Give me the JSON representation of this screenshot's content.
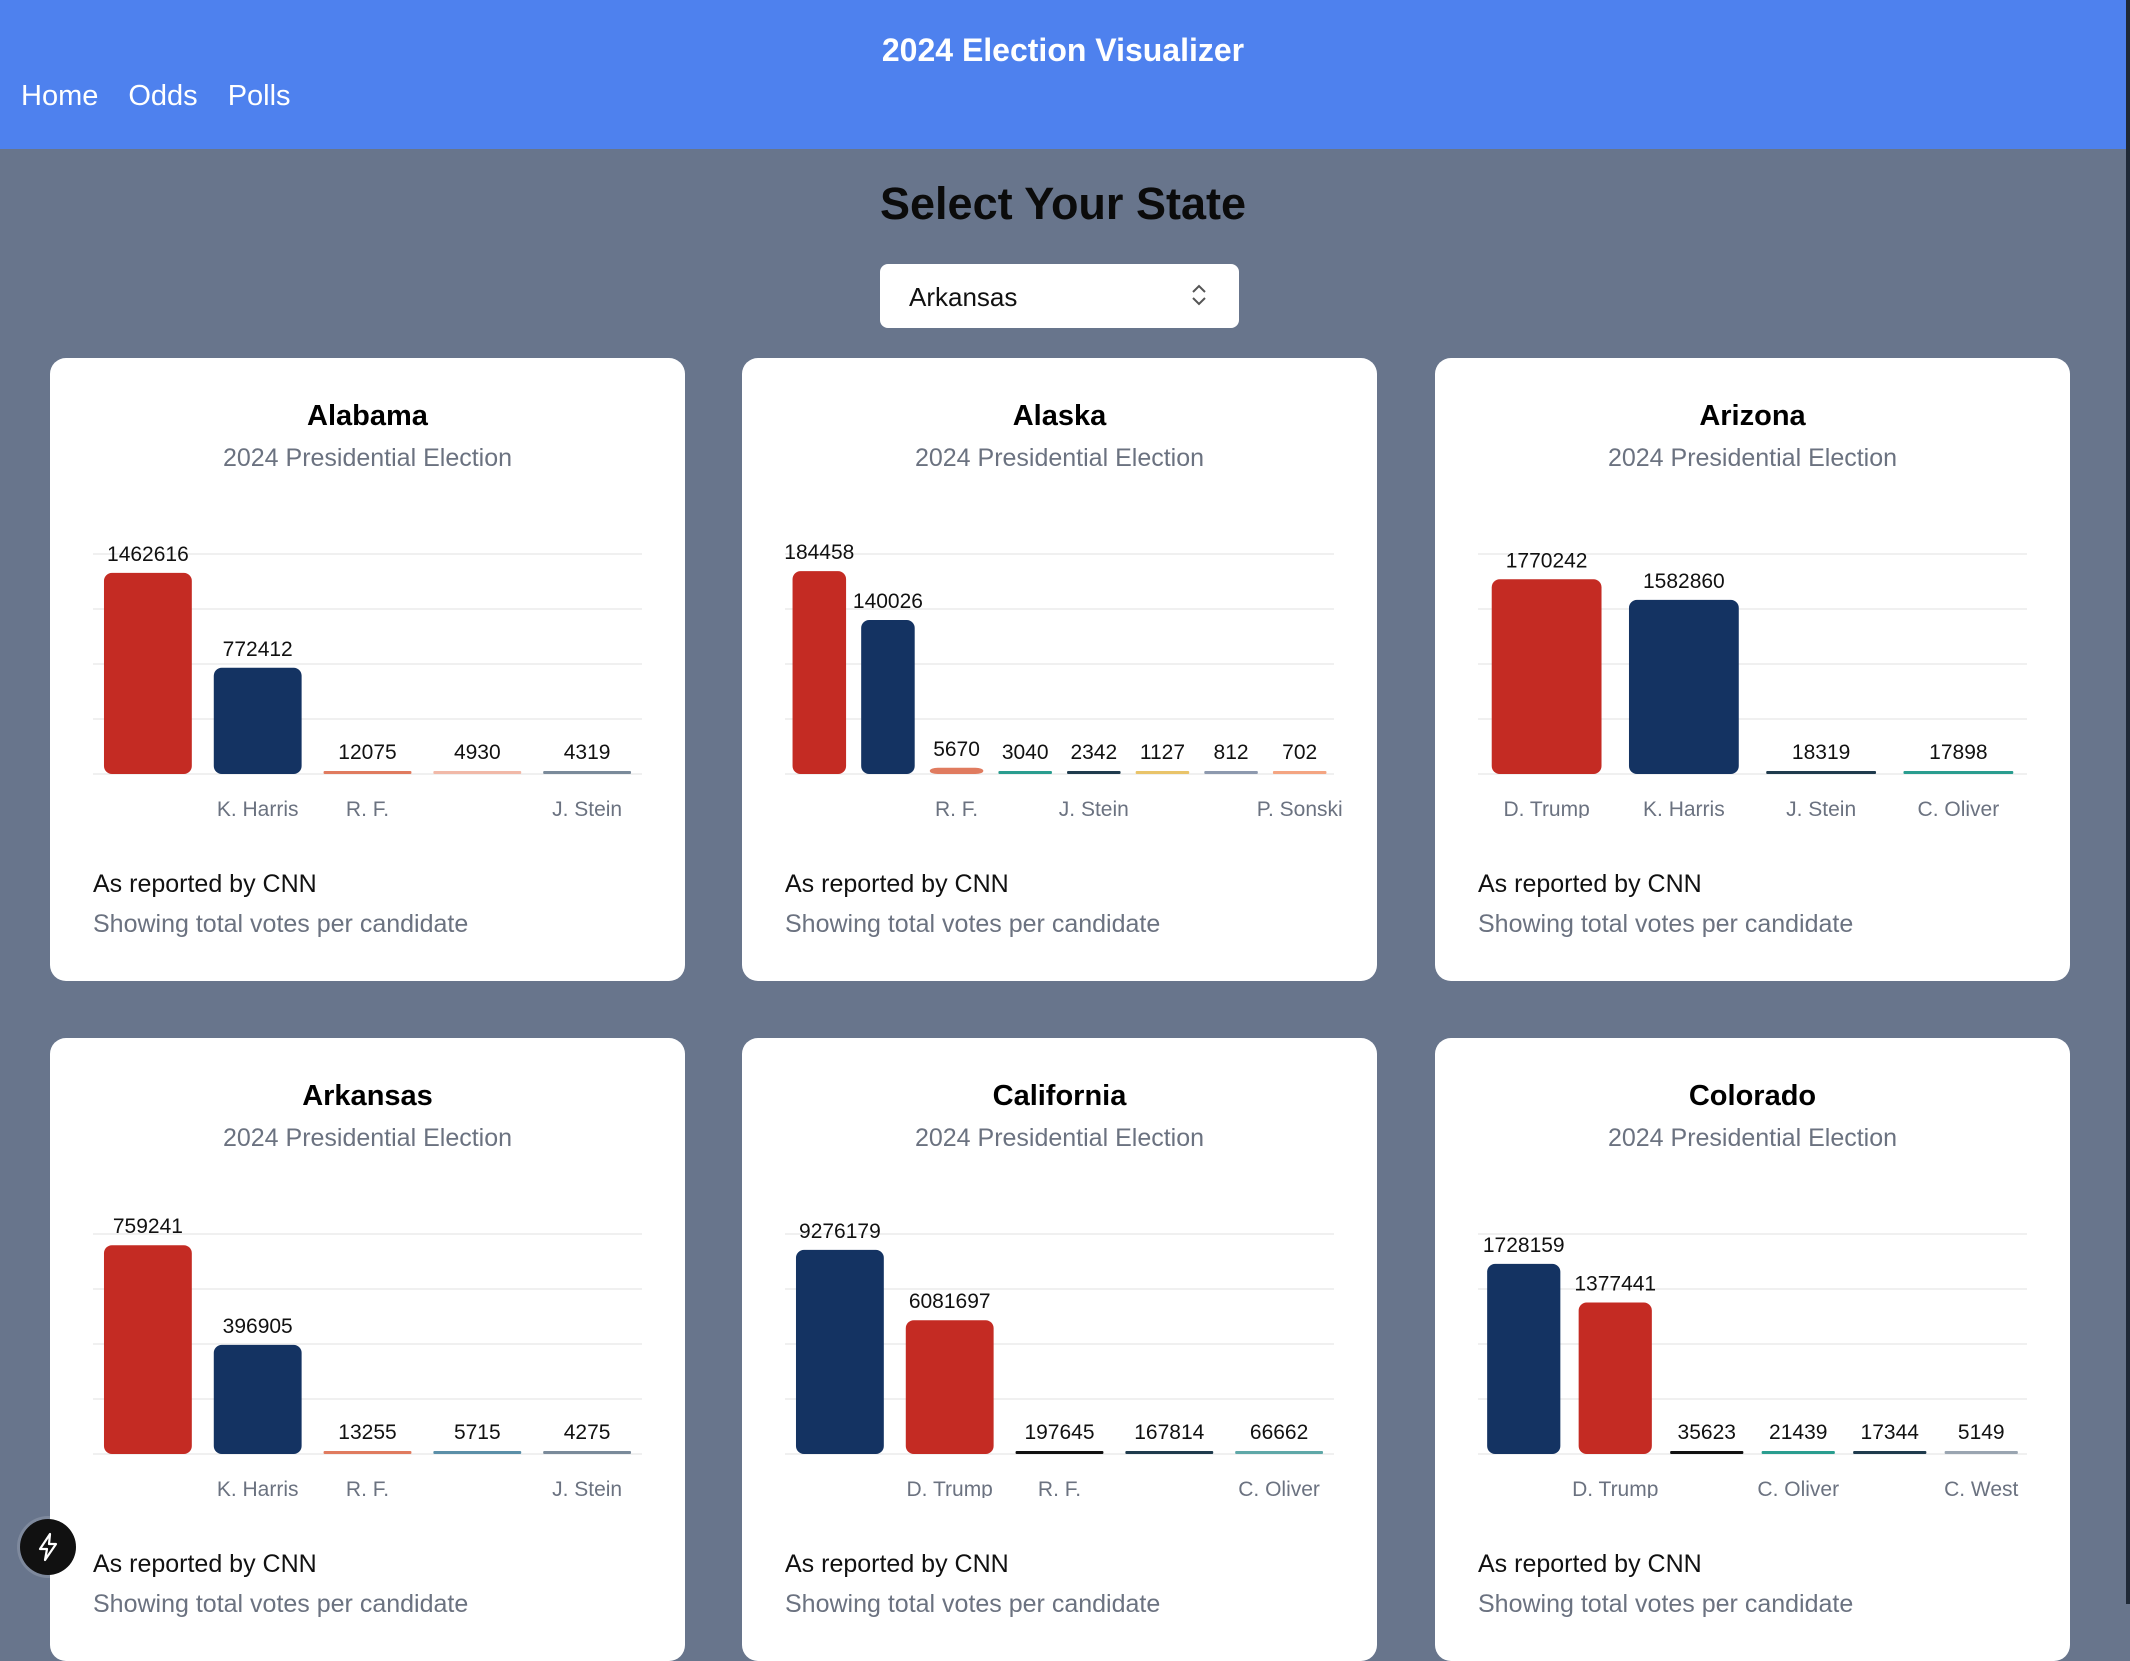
{
  "app": {
    "title": "2024 Election Visualizer",
    "nav": [
      "Home",
      "Odds",
      "Polls"
    ]
  },
  "main": {
    "heading": "Select Your State",
    "state_select": {
      "value": "Arkansas"
    }
  },
  "card_footer": {
    "source": "As reported by CNN",
    "note": "Showing total votes per candidate"
  },
  "colors": {
    "header": "#4e81ee",
    "background": "#68758c",
    "republican": "#c42b23",
    "democrat": "#143362"
  },
  "chart_data": [
    {
      "type": "bar",
      "title": "Alabama",
      "subtitle": "2024 Presidential Election",
      "categories": [
        "",
        "K. Harris",
        "R. F.",
        "",
        "J. Stein"
      ],
      "values": [
        1462616,
        772412,
        12075,
        4930,
        4319
      ],
      "colors": [
        "#c42b23",
        "#143362",
        "#e07b5f",
        "#f1b9a8",
        "#7a8a9a"
      ],
      "ylim": [
        0,
        1600000
      ],
      "grid": true
    },
    {
      "type": "bar",
      "title": "Alaska",
      "subtitle": "2024 Presidential Election",
      "categories": [
        "",
        "",
        "R. F.",
        "",
        "J. Stein",
        "",
        "",
        "P. Sonski"
      ],
      "values": [
        184458,
        140026,
        5670,
        3040,
        2342,
        1127,
        812,
        702
      ],
      "colors": [
        "#c42b23",
        "#143362",
        "#e07b5f",
        "#2a9d8f",
        "#1f3b4d",
        "#e9c46a",
        "#8d99ae",
        "#f4a582"
      ],
      "ylim": [
        0,
        200000
      ],
      "grid": true
    },
    {
      "type": "bar",
      "title": "Arizona",
      "subtitle": "2024 Presidential Election",
      "categories": [
        "D. Trump",
        "K. Harris",
        "J. Stein",
        "C. Oliver"
      ],
      "values": [
        1770242,
        1582860,
        18319,
        17898
      ],
      "colors": [
        "#c42b23",
        "#143362",
        "#1f3b4d",
        "#2a9d8f"
      ],
      "ylim": [
        0,
        2000000
      ],
      "grid": true
    },
    {
      "type": "bar",
      "title": "Arkansas",
      "subtitle": "2024 Presidential Election",
      "categories": [
        "",
        "K. Harris",
        "R. F.",
        "",
        "J. Stein"
      ],
      "values": [
        759241,
        396905,
        13255,
        5715,
        4275
      ],
      "colors": [
        "#c42b23",
        "#143362",
        "#e07b5f",
        "#5b8fa8",
        "#7a8a9a"
      ],
      "ylim": [
        0,
        800000
      ],
      "grid": true
    },
    {
      "type": "bar",
      "title": "California",
      "subtitle": "2024 Presidential Election",
      "categories": [
        "",
        "D. Trump",
        "R. F.",
        "",
        "C. Oliver"
      ],
      "values": [
        9276179,
        6081697,
        197645,
        167814,
        66662
      ],
      "colors": [
        "#143362",
        "#c42b23",
        "#111111",
        "#1f3b4d",
        "#5fa8a8"
      ],
      "ylim": [
        0,
        10000000
      ],
      "grid": true
    },
    {
      "type": "bar",
      "title": "Colorado",
      "subtitle": "2024 Presidential Election",
      "categories": [
        "",
        "D. Trump",
        "",
        "C. Oliver",
        "",
        "C. West"
      ],
      "values": [
        1728159,
        1377441,
        35623,
        21439,
        17344,
        5149
      ],
      "colors": [
        "#143362",
        "#c42b23",
        "#111111",
        "#2a9d8f",
        "#1f3b4d",
        "#9aa5b1"
      ],
      "ylim": [
        0,
        2000000
      ],
      "grid": true
    }
  ]
}
